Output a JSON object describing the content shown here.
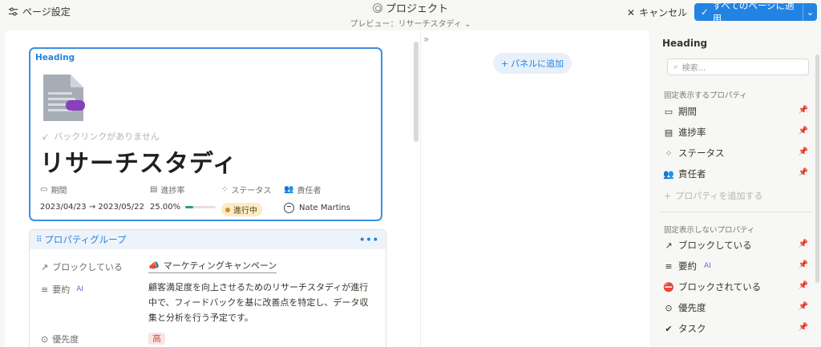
{
  "topbar": {
    "page_settings": "ページ設定",
    "title": "プロジェクト",
    "preview": "プレビュー：リサーチスタディ",
    "cancel": "キャンセル",
    "apply": "すべてのページに適用"
  },
  "canvas": {
    "add_panel": "パネルに追加"
  },
  "heading": {
    "label": "Heading",
    "backlinks": "バックリンクがありません",
    "page_name": "リサーチスタディ",
    "props": {
      "period_label": "期間",
      "period_value": "2023/04/23 → 2023/05/22",
      "progress_label": "進捗率",
      "progress_value": "25.00%",
      "progress_fraction": 0.25,
      "status_label": "ステータス",
      "status_value": "進行中",
      "owner_label": "責任者",
      "owner_value": "Nate Martins"
    }
  },
  "group": {
    "title": "プロパティグループ",
    "rows": {
      "blocking_label": "ブロックしている",
      "blocking_value": "マーケティングキャンペーン",
      "summary_label": "要約",
      "summary_ai": "AI",
      "summary_value": "顧客満足度を向上させるためのリサーチスタディが進行中で、フィードバックを基に改善点を特定し、データ収集と分析を行う予定です。",
      "priority_label": "優先度",
      "priority_value": "高"
    }
  },
  "panel": {
    "title": "Heading",
    "search_placeholder": "検索...",
    "pinned_label": "固定表示するプロパティ",
    "pinned": [
      {
        "label": "期間"
      },
      {
        "label": "進捗率"
      },
      {
        "label": "ステータス"
      },
      {
        "label": "責任者"
      }
    ],
    "add_property": "プロパティを追加する",
    "unpinned_label": "固定表示しないプロパティ",
    "unpinned": [
      {
        "label": "ブロックしている"
      },
      {
        "label": "要約",
        "ai": "AI"
      },
      {
        "label": "ブロックされている"
      },
      {
        "label": "優先度"
      },
      {
        "label": "タスク"
      }
    ]
  },
  "colors": {
    "accent": "#2383e2",
    "status_bg": "#fbecc8",
    "priority_bg": "#fbe4e4",
    "progress": "#2f9e6b"
  }
}
